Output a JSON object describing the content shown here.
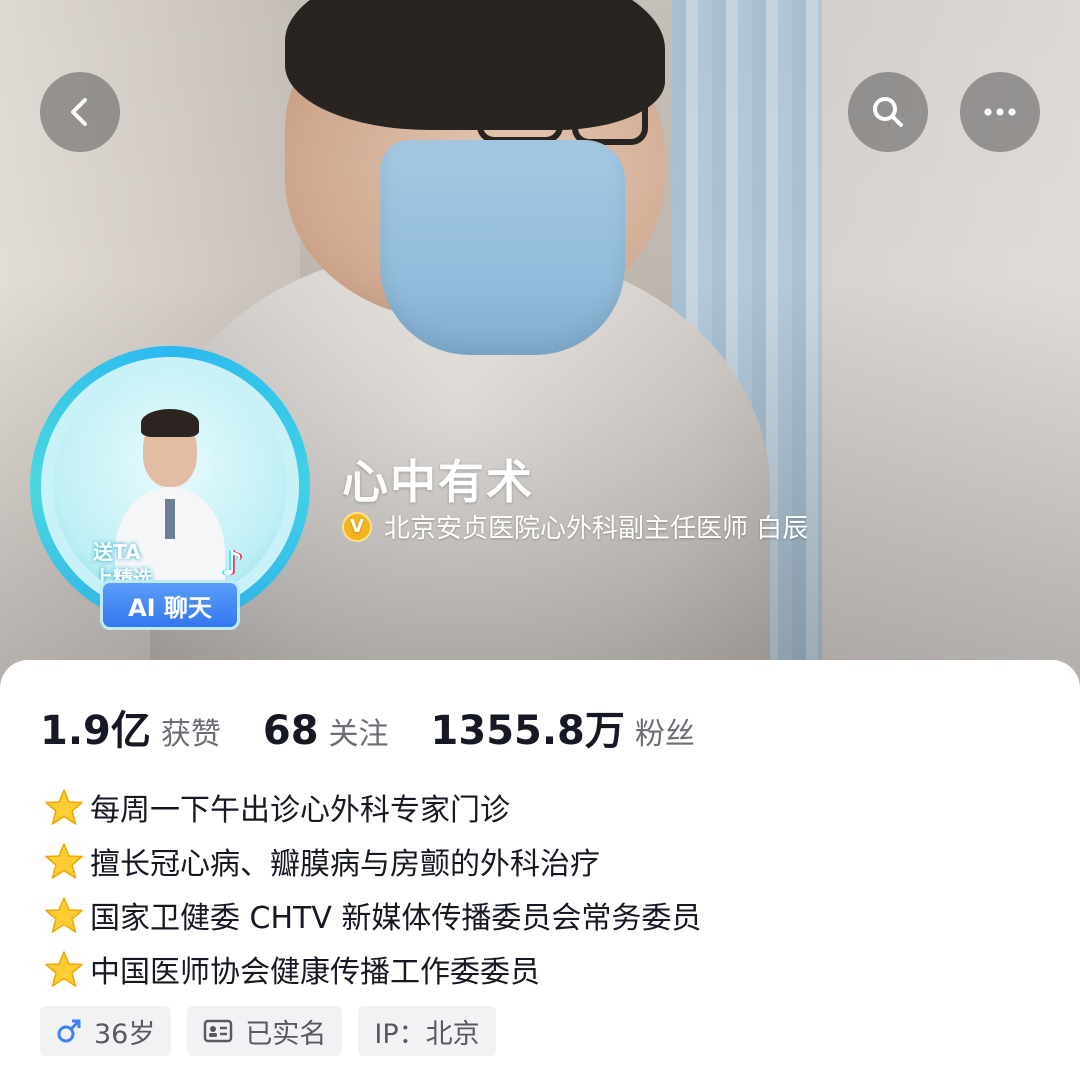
{
  "header": {
    "back_icon": "chevron-left-icon",
    "search_icon": "search-icon",
    "more_icon": "more-horizontal-icon"
  },
  "profile": {
    "name": "心中有术",
    "verified_badge": "V",
    "verification": "北京安贞医院心外科副主任医师 白辰",
    "avatar_promo_line1": "送TA",
    "avatar_promo_line2": "上精选",
    "ai_chip_label": "AI 聊天"
  },
  "stats": [
    {
      "value": "1.9亿",
      "label": "获赞"
    },
    {
      "value": "68",
      "label": "关注"
    },
    {
      "value": "1355.8万",
      "label": "粉丝"
    }
  ],
  "bio": [
    "每周一下午出诊心外科专家门诊",
    "擅长冠心病、瓣膜病与房颤的外科治疗",
    "国家卫健委 CHTV 新媒体传播委员会常务委员",
    "中国医师协会健康传播工作委委员"
  ],
  "tags": {
    "gender_age": "36岁",
    "real_name": "已实名",
    "ip": "IP：北京"
  },
  "colors": {
    "accent_blue": "#3477ee",
    "ring_cyan": "#2bb8f0",
    "verify_gold": "#f2b51e",
    "text_primary": "#161823",
    "text_secondary": "#6b6e76"
  }
}
